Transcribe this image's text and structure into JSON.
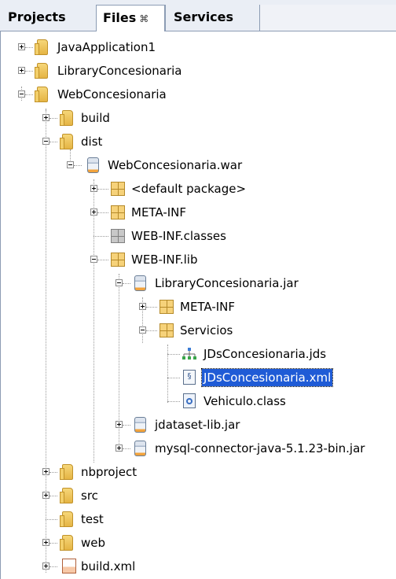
{
  "tabs": {
    "projects": "Projects",
    "files": "Files",
    "files_close": "⌘",
    "services": "Services"
  },
  "tree": {
    "java_application1": "JavaApplication1",
    "library_concesionaria": "LibraryConcesionaria",
    "web_concesionaria": "WebConcesionaria",
    "build": "build",
    "dist": "dist",
    "war": "WebConcesionaria.war",
    "default_package": "<default package>",
    "meta_inf": "META-INF",
    "web_inf_classes": "WEB-INF.classes",
    "web_inf_lib": "WEB-INF.lib",
    "library_jar": "LibraryConcesionaria.jar",
    "jar_meta_inf": "META-INF",
    "servicios": "Servicios",
    "jds": "JDsConcesionaria.jds",
    "xml": "JDsConcesionaria.xml",
    "vehiculo_class": "Vehiculo.class",
    "jdataset_jar": "jdataset-lib.jar",
    "mysql_jar": "mysql-connector-java-5.1.23-bin.jar",
    "nbproject": "nbproject",
    "src": "src",
    "test": "test",
    "web": "web",
    "build_xml": "build.xml"
  },
  "colors": {
    "selection": "#1f5bd6",
    "tab_border": "#8c9cb4"
  }
}
